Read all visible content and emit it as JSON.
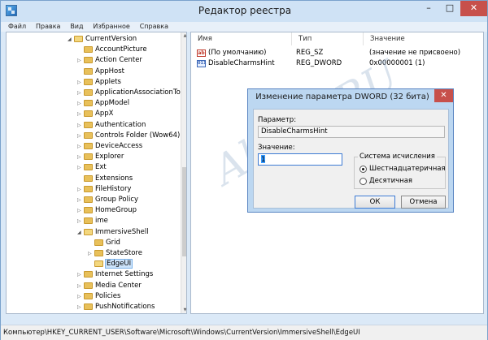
{
  "window": {
    "title": "Редактор реестра",
    "min": "–",
    "max": "□",
    "close": "✕"
  },
  "menu": [
    "Файл",
    "Правка",
    "Вид",
    "Избранное",
    "Справка"
  ],
  "tree": [
    {
      "label": "CurrentVersion",
      "arrow": "◢",
      "open": true
    },
    {
      "label": "AccountPicture",
      "arrow": ""
    },
    {
      "label": "Action Center",
      "arrow": "▷"
    },
    {
      "label": "AppHost",
      "arrow": ""
    },
    {
      "label": "Applets",
      "arrow": "▷"
    },
    {
      "label": "ApplicationAssociationTo",
      "arrow": "▷"
    },
    {
      "label": "AppModel",
      "arrow": "▷"
    },
    {
      "label": "AppX",
      "arrow": "▷"
    },
    {
      "label": "Authentication",
      "arrow": "▷"
    },
    {
      "label": "Controls Folder (Wow64)",
      "arrow": "▷"
    },
    {
      "label": "DeviceAccess",
      "arrow": "▷"
    },
    {
      "label": "Explorer",
      "arrow": "▷"
    },
    {
      "label": "Ext",
      "arrow": "▷"
    },
    {
      "label": "Extensions",
      "arrow": ""
    },
    {
      "label": "FileHistory",
      "arrow": "▷"
    },
    {
      "label": "Group Policy",
      "arrow": "▷"
    },
    {
      "label": "HomeGroup",
      "arrow": "▷"
    },
    {
      "label": "ime",
      "arrow": "▷"
    },
    {
      "label": "ImmersiveShell",
      "arrow": "◢",
      "open": true
    },
    {
      "label": "Grid",
      "arrow": "",
      "sub": true
    },
    {
      "label": "StateStore",
      "arrow": "▷",
      "sub": true
    },
    {
      "label": "EdgeUI",
      "arrow": "",
      "sub": true,
      "selected": true
    },
    {
      "label": "Internet Settings",
      "arrow": "▷"
    },
    {
      "label": "Media Center",
      "arrow": "▷"
    },
    {
      "label": "Policies",
      "arrow": "▷"
    },
    {
      "label": "PushNotifications",
      "arrow": "▷"
    }
  ],
  "list": {
    "columns": [
      "Имя",
      "Тип",
      "Значение"
    ],
    "rows": [
      {
        "icon": "ab",
        "name": "(По умолчанию)",
        "type": "REG_SZ",
        "value": "(значение не присвоено)"
      },
      {
        "icon": "011",
        "name": "DisableCharmsHint",
        "type": "REG_DWORD",
        "value": "0x00000001 (1)"
      }
    ]
  },
  "statusbar": "Компьютер\\HKEY_CURRENT_USER\\Software\\Microsoft\\Windows\\CurrentVersion\\ImmersiveShell\\EdgeUI",
  "dialog": {
    "title": "Изменение параметра DWORD (32 бита)",
    "close": "✕",
    "param_label": "Параметр:",
    "param_value": "DisableCharmsHint",
    "value_label": "Значение:",
    "value": "1",
    "base_title": "Система исчисления",
    "hex_label": "Шестнадцатеричная",
    "dec_label": "Десятичная",
    "ok": "ОК",
    "cancel": "Отмена"
  },
  "watermark": "All4os.RU",
  "scroll": {
    "up": "▲",
    "down": "▼"
  }
}
